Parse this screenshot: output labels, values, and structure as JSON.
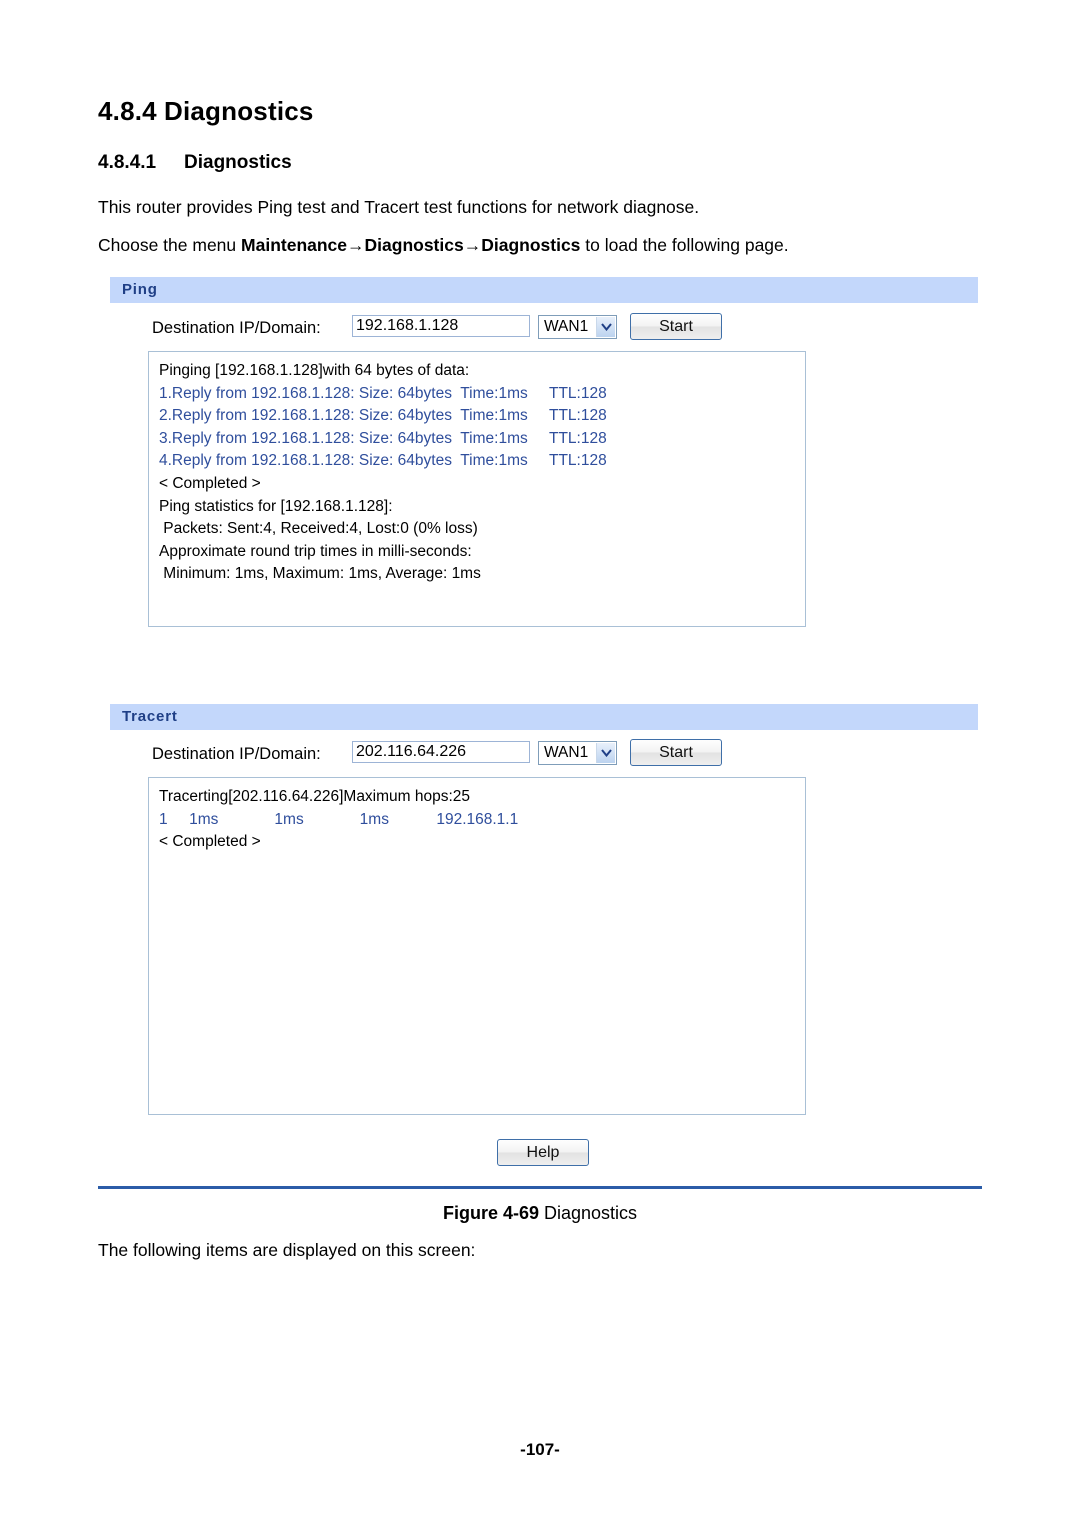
{
  "document": {
    "section_number": "4.8.4",
    "section_title": "Diagnostics",
    "subsection_number": "4.8.4.1",
    "subsection_title": "Diagnostics",
    "intro_paragraph": "This router provides Ping test and Tracert test functions for network diagnose.",
    "menu_paragraph": {
      "prefix": "Choose the menu ",
      "menu_1": "Maintenance",
      "arrow_1": "→",
      "menu_2": "Diagnostics",
      "arrow_2": "→",
      "menu_3": "Diagnostics",
      "suffix": " to load the following page."
    },
    "figure_caption_label": "Figure 4-69",
    "figure_caption_text": " Diagnostics",
    "closing_paragraph": "The following items are displayed on this screen:",
    "page_number": "-107-"
  },
  "colors": {
    "panel_header_bg": "#c3d7fb",
    "panel_header_text": "#1f3f86",
    "console_reply_text": "#2f4e9c",
    "rule_blue": "#2b5ca8",
    "input_border": "#9db4d6",
    "button_border": "#3f6fa8"
  },
  "ping": {
    "panel_title": "Ping",
    "field_label": "Destination IP/Domain:",
    "input_value": "192.168.1.128",
    "input_placeholder": "",
    "interface_selected": "WAN1",
    "interface_options": [
      "WAN1"
    ],
    "start_label": "Start",
    "console_lines": [
      {
        "text": "Pinging [192.168.1.128]with 64 bytes of data:",
        "style": "plain"
      },
      {
        "text": "1.Reply from 192.168.1.128: Size: 64bytes  Time:1ms     TTL:128",
        "style": "blue"
      },
      {
        "text": "2.Reply from 192.168.1.128: Size: 64bytes  Time:1ms     TTL:128",
        "style": "blue"
      },
      {
        "text": "3.Reply from 192.168.1.128: Size: 64bytes  Time:1ms     TTL:128",
        "style": "blue"
      },
      {
        "text": "4.Reply from 192.168.1.128: Size: 64bytes  Time:1ms     TTL:128",
        "style": "blue"
      },
      {
        "text": "< Completed >",
        "style": "plain"
      },
      {
        "text": "Ping statistics for [192.168.1.128]:",
        "style": "plain"
      },
      {
        "text": " Packets: Sent:4, Received:4, Lost:0 (0% loss)",
        "style": "plain"
      },
      {
        "text": "Approximate round trip times in milli-seconds:",
        "style": "plain"
      },
      {
        "text": " Minimum: 1ms, Maximum: 1ms, Average: 1ms",
        "style": "plain"
      }
    ]
  },
  "tracert": {
    "panel_title": "Tracert",
    "field_label": "Destination IP/Domain:",
    "input_value": "202.116.64.226",
    "input_placeholder": "",
    "interface_selected": "WAN1",
    "interface_options": [
      "WAN1"
    ],
    "start_label": "Start",
    "console_lines": [
      {
        "text": "Tracerting[202.116.64.226]Maximum hops:25",
        "style": "plain"
      },
      {
        "text": "1     1ms             1ms             1ms           192.168.1.1",
        "style": "blue"
      },
      {
        "text": "< Completed >",
        "style": "plain"
      }
    ]
  },
  "footer": {
    "help_label": "Help"
  },
  "icons": {
    "dropdown": "chevron-down-icon"
  }
}
